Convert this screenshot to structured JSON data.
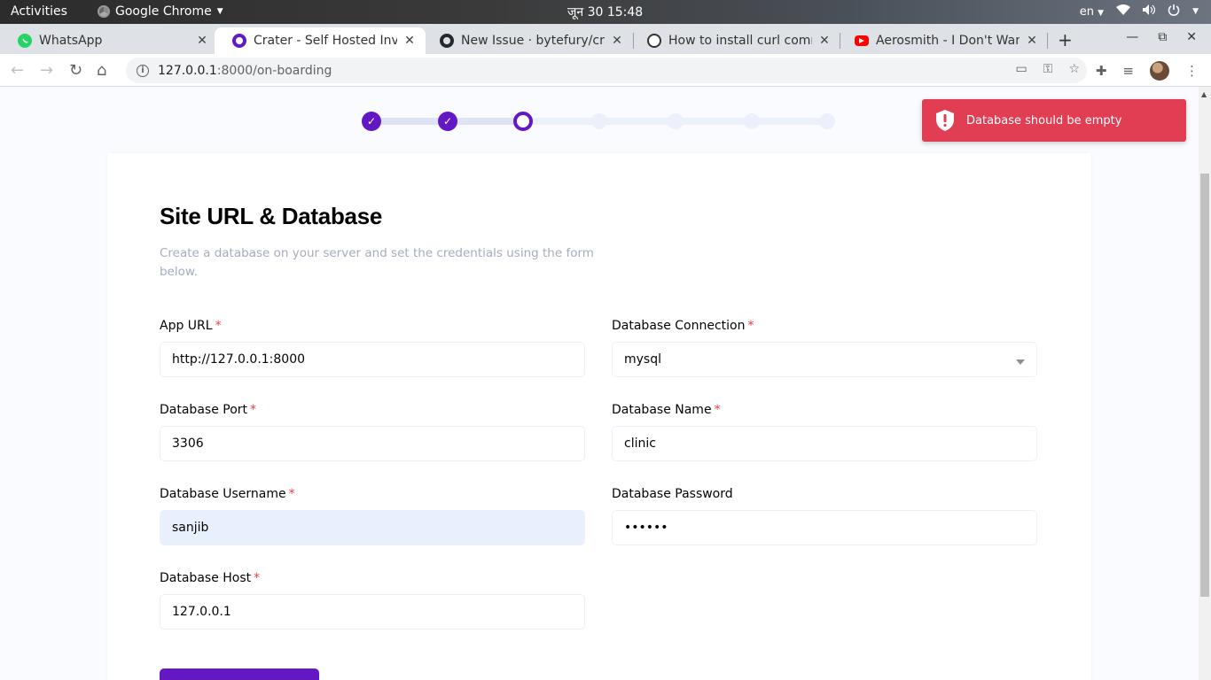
{
  "os": {
    "activities": "Activities",
    "app_name": "Google Chrome",
    "clock": "जून 30  15:48",
    "lang": "en"
  },
  "tabs": [
    {
      "title": "WhatsApp",
      "icon": "whatsapp-icon",
      "color": "#25d366"
    },
    {
      "title": "Crater - Self Hosted Invoi",
      "icon": "crater-icon",
      "color": "#6418c3"
    },
    {
      "title": "New Issue · bytefury/crat",
      "icon": "github-icon",
      "color": "#24292e"
    },
    {
      "title": "How to install curl comm",
      "icon": "ubuntu-icon",
      "color": "#333333"
    },
    {
      "title": "Aerosmith - I Don't Wann",
      "icon": "youtube-icon",
      "color": "#ff0000"
    }
  ],
  "address": {
    "host": "127.0.0.1",
    "path": ":8000/on-boarding"
  },
  "stepper": {
    "total_steps": 7,
    "completed": 2,
    "current": 3
  },
  "form": {
    "title": "Site URL & Database",
    "description": "Create a database on your server and set the credentials using the form below.",
    "required_mark": "*",
    "app_url": {
      "label": "App URL",
      "value": "http://127.0.0.1:8000"
    },
    "db_connection": {
      "label": "Database Connection",
      "value": "mysql"
    },
    "db_port": {
      "label": "Database Port",
      "value": "3306"
    },
    "db_name": {
      "label": "Database Name",
      "value": "clinic"
    },
    "db_username": {
      "label": "Database Username",
      "value": "sanjib"
    },
    "db_password": {
      "label": "Database Password",
      "value": "••••••"
    },
    "db_host": {
      "label": "Database Host",
      "value": "127.0.0.1"
    }
  },
  "toast": {
    "message": "Database should be empty",
    "color": "#e13e53"
  },
  "colors": {
    "primary": "#6418c3"
  }
}
